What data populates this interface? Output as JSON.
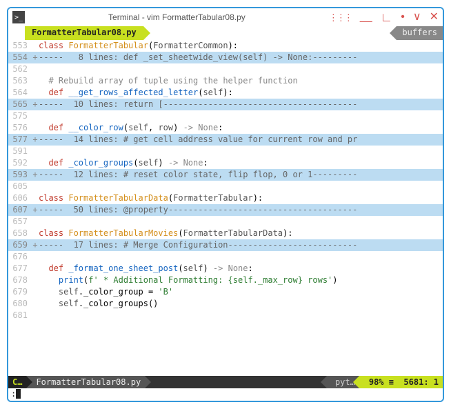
{
  "window": {
    "title": "Terminal - vim FormatterTabular08.py"
  },
  "tabs": {
    "active": "FormatterTabular08.py",
    "right_label": "buffers"
  },
  "lines": [
    {
      "num": "553",
      "fold": " ",
      "type": "code",
      "segs": [
        {
          "cls": "kw",
          "t": "class "
        },
        {
          "cls": "cls",
          "t": "FormatterTabular"
        },
        {
          "cls": "",
          "t": "("
        },
        {
          "cls": "param",
          "t": "FormatterCommon"
        },
        {
          "cls": "",
          "t": "):"
        }
      ]
    },
    {
      "num": "554",
      "fold": "+",
      "type": "fold",
      "text": "-----   8 lines: def _set_sheetwide_view(self) -> None:---------"
    },
    {
      "num": "562",
      "fold": " ",
      "type": "blank"
    },
    {
      "num": "563",
      "fold": " ",
      "type": "code",
      "segs": [
        {
          "cls": "",
          "t": "  "
        },
        {
          "cls": "cmt",
          "t": "# Rebuild array of tuple using the helper function"
        }
      ]
    },
    {
      "num": "564",
      "fold": " ",
      "type": "code",
      "segs": [
        {
          "cls": "",
          "t": "  "
        },
        {
          "cls": "kw",
          "t": "def "
        },
        {
          "cls": "fn",
          "t": "__get_rows_affected_letter"
        },
        {
          "cls": "",
          "t": "("
        },
        {
          "cls": "self",
          "t": "self"
        },
        {
          "cls": "",
          "t": "):"
        }
      ]
    },
    {
      "num": "565",
      "fold": "+",
      "type": "fold",
      "text": "-----  10 lines: return [---------------------------------------"
    },
    {
      "num": "575",
      "fold": " ",
      "type": "blank"
    },
    {
      "num": "576",
      "fold": " ",
      "type": "code",
      "segs": [
        {
          "cls": "",
          "t": "  "
        },
        {
          "cls": "kw",
          "t": "def "
        },
        {
          "cls": "fn",
          "t": "__color_row"
        },
        {
          "cls": "",
          "t": "("
        },
        {
          "cls": "self",
          "t": "self"
        },
        {
          "cls": "",
          "t": ", "
        },
        {
          "cls": "param",
          "t": "row"
        },
        {
          "cls": "",
          "t": ") "
        },
        {
          "cls": "arrow",
          "t": "-> "
        },
        {
          "cls": "none",
          "t": "None"
        },
        {
          "cls": "",
          "t": ":"
        }
      ]
    },
    {
      "num": "577",
      "fold": "+",
      "type": "fold",
      "text": "-----  14 lines: # get cell address value for current row and pr"
    },
    {
      "num": "591",
      "fold": " ",
      "type": "blank"
    },
    {
      "num": "592",
      "fold": " ",
      "type": "code",
      "segs": [
        {
          "cls": "",
          "t": "  "
        },
        {
          "cls": "kw",
          "t": "def "
        },
        {
          "cls": "fn",
          "t": "_color_groups"
        },
        {
          "cls": "",
          "t": "("
        },
        {
          "cls": "self",
          "t": "self"
        },
        {
          "cls": "",
          "t": ") "
        },
        {
          "cls": "arrow",
          "t": "-> "
        },
        {
          "cls": "none",
          "t": "None"
        },
        {
          "cls": "",
          "t": ":"
        }
      ]
    },
    {
      "num": "593",
      "fold": "+",
      "type": "fold",
      "text": "-----  12 lines: # reset color state, flip flop, 0 or 1---------"
    },
    {
      "num": "605",
      "fold": " ",
      "type": "blank"
    },
    {
      "num": "606",
      "fold": " ",
      "type": "code",
      "segs": [
        {
          "cls": "kw",
          "t": "class "
        },
        {
          "cls": "cls",
          "t": "FormatterTabularData"
        },
        {
          "cls": "",
          "t": "("
        },
        {
          "cls": "param",
          "t": "FormatterTabular"
        },
        {
          "cls": "",
          "t": "):"
        }
      ]
    },
    {
      "num": "607",
      "fold": "+",
      "type": "fold",
      "text": "-----  50 lines: @property--------------------------------------"
    },
    {
      "num": "657",
      "fold": " ",
      "type": "blank"
    },
    {
      "num": "658",
      "fold": " ",
      "type": "code",
      "segs": [
        {
          "cls": "kw",
          "t": "class "
        },
        {
          "cls": "cls",
          "t": "FormatterTabularMovies"
        },
        {
          "cls": "",
          "t": "("
        },
        {
          "cls": "param",
          "t": "FormatterTabularData"
        },
        {
          "cls": "",
          "t": "):"
        }
      ]
    },
    {
      "num": "659",
      "fold": "+",
      "type": "fold",
      "text": "-----  17 lines: # Merge Configuration--------------------------"
    },
    {
      "num": "676",
      "fold": " ",
      "type": "blank"
    },
    {
      "num": "677",
      "fold": " ",
      "type": "code",
      "segs": [
        {
          "cls": "",
          "t": "  "
        },
        {
          "cls": "kw",
          "t": "def "
        },
        {
          "cls": "fn",
          "t": "_format_one_sheet_post"
        },
        {
          "cls": "",
          "t": "("
        },
        {
          "cls": "self",
          "t": "self"
        },
        {
          "cls": "",
          "t": ") "
        },
        {
          "cls": "arrow",
          "t": "-> "
        },
        {
          "cls": "none",
          "t": "None"
        },
        {
          "cls": "",
          "t": ":"
        }
      ]
    },
    {
      "num": "678",
      "fold": " ",
      "type": "code",
      "segs": [
        {
          "cls": "",
          "t": "    "
        },
        {
          "cls": "fn",
          "t": "print"
        },
        {
          "cls": "",
          "t": "("
        },
        {
          "cls": "str",
          "t": "f' * Additional Formatting: {self._max_row} rows'"
        },
        {
          "cls": "",
          "t": ")"
        }
      ]
    },
    {
      "num": "679",
      "fold": " ",
      "type": "code",
      "segs": [
        {
          "cls": "",
          "t": "    "
        },
        {
          "cls": "self",
          "t": "self"
        },
        {
          "cls": "",
          "t": "._color_group = "
        },
        {
          "cls": "str",
          "t": "'B'"
        }
      ]
    },
    {
      "num": "680",
      "fold": " ",
      "type": "code",
      "segs": [
        {
          "cls": "",
          "t": "    "
        },
        {
          "cls": "self",
          "t": "self"
        },
        {
          "cls": "",
          "t": "._color_groups()"
        }
      ]
    },
    {
      "num": "681",
      "fold": " ",
      "type": "blank"
    }
  ],
  "status": {
    "mode": "C…",
    "file": "FormatterTabular08.py",
    "filetype": "pyt…",
    "percent": "98% ≡",
    "pos": "5681: 1"
  },
  "cmdline": ":"
}
